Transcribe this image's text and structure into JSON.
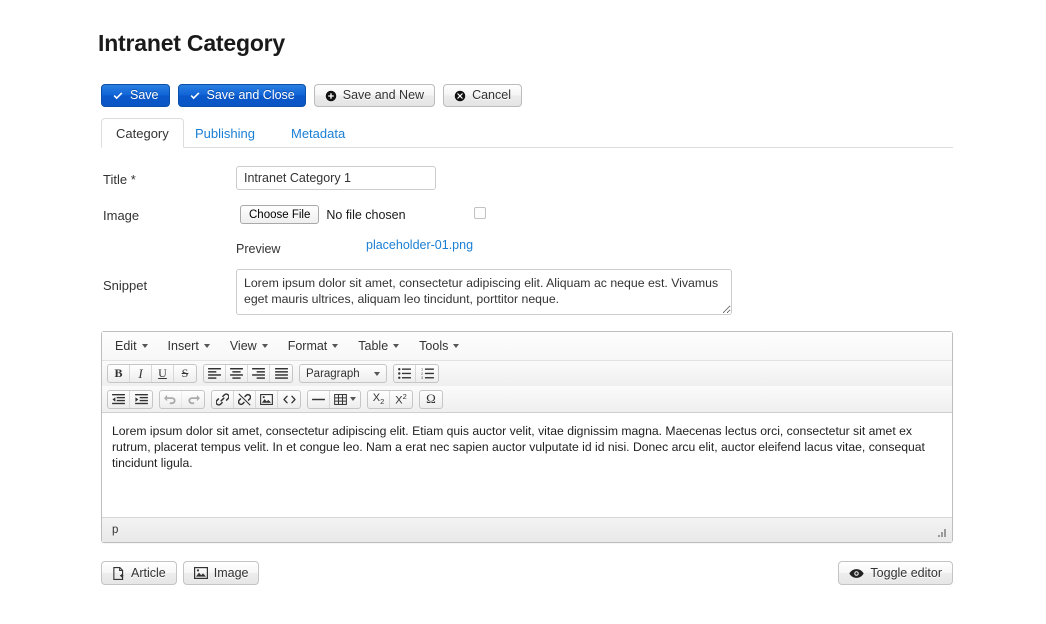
{
  "page_title": "Intranet Category",
  "toolbar": {
    "buttons": [
      {
        "label": "Save",
        "icon": "check-icon",
        "style": "primary"
      },
      {
        "label": "Save and Close",
        "icon": "check-icon",
        "style": "primary"
      },
      {
        "label": "Save and New",
        "icon": "circle-plus-icon",
        "style": "default"
      },
      {
        "label": "Cancel",
        "icon": "circle-x-icon",
        "style": "default"
      }
    ]
  },
  "tabs": [
    {
      "label": "Category",
      "active": true
    },
    {
      "label": "Publishing",
      "active": false
    },
    {
      "label": "Metadata",
      "active": false
    }
  ],
  "form": {
    "title": {
      "label": "Title *",
      "value": "Intranet Category 1",
      "placeholder": ""
    },
    "image": {
      "label": "Image",
      "choose_file_label": "Choose File",
      "file_status": "No file chosen",
      "checkbox_checked": false
    },
    "preview": {
      "label": "Preview",
      "file_link": "placeholder-01.png"
    },
    "snippet": {
      "label": "Snippet",
      "value": "Lorem ipsum dolor sit amet, consectetur adipiscing elit. Aliquam ac neque est. Vivamus eget mauris ultrices, aliquam leo tincidunt, porttitor neque.",
      "placeholder": ""
    }
  },
  "editor": {
    "menubar": [
      {
        "label": "Edit"
      },
      {
        "label": "Insert"
      },
      {
        "label": "View"
      },
      {
        "label": "Format"
      },
      {
        "label": "Table"
      },
      {
        "label": "Tools"
      }
    ],
    "toolbar_row1": {
      "format_group": [
        {
          "name": "bold-icon",
          "glyph": "B"
        },
        {
          "name": "italic-icon",
          "glyph": "I"
        },
        {
          "name": "underline-icon",
          "glyph": "U"
        },
        {
          "name": "strikethrough-icon",
          "glyph": "S"
        }
      ],
      "align_group": [
        {
          "name": "align-left-icon"
        },
        {
          "name": "align-center-icon"
        },
        {
          "name": "align-right-icon"
        },
        {
          "name": "align-justify-icon"
        }
      ],
      "style_select": "Paragraph",
      "list_group": [
        {
          "name": "bullet-list-icon"
        },
        {
          "name": "numbered-list-icon"
        }
      ]
    },
    "toolbar_row2": {
      "indent_group": [
        {
          "name": "outdent-icon"
        },
        {
          "name": "indent-icon"
        }
      ],
      "history_group": [
        {
          "name": "undo-icon"
        },
        {
          "name": "redo-icon"
        }
      ],
      "insert_group": [
        {
          "name": "link-icon"
        },
        {
          "name": "unlink-icon"
        },
        {
          "name": "image-icon"
        },
        {
          "name": "source-code-icon"
        }
      ],
      "object_group": [
        {
          "name": "horizontal-rule-icon"
        },
        {
          "name": "table-icon"
        }
      ],
      "script_group": [
        {
          "name": "subscript-icon"
        },
        {
          "name": "superscript-icon"
        }
      ],
      "special_char": {
        "name": "special-character-icon",
        "glyph": "Ω"
      }
    },
    "content": "Lorem ipsum dolor sit amet, consectetur adipiscing elit. Etiam quis auctor velit, vitae dignissim magna. Maecenas lectus orci, consectetur sit amet ex rutrum, placerat tempus velit. In et congue leo. Nam a erat nec sapien auctor vulputate id id nisi. Donec arcu elit, auctor eleifend lacus vitae, consequat tincidunt ligula.",
    "status_path": "p"
  },
  "bottom_buttons": {
    "article": {
      "label": "Article",
      "icon": "article-icon"
    },
    "image": {
      "label": "Image",
      "icon": "image-icon"
    },
    "toggle_editor": {
      "label": "Toggle editor",
      "icon": "eye-icon"
    }
  },
  "colors": {
    "primary_blue": "#0f62d6",
    "link_blue": "#1a7fd4",
    "text": "#333333",
    "border": "#cccccc"
  }
}
